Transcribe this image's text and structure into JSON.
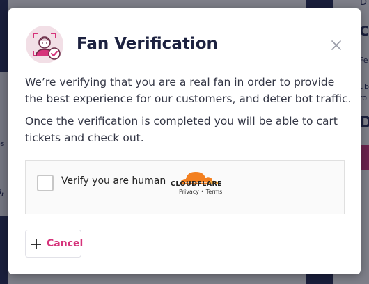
{
  "background": {
    "right_top_char": "D",
    "right_heading_char": "C",
    "right_small_1": "Fe",
    "right_small_2": "ub",
    "right_small_3": "ro",
    "right_big_char": "D",
    "left_small_1": "es",
    "left_small_2": "s,"
  },
  "modal": {
    "title": "Fan Verification",
    "paragraph_1": "We’re verifying that you are a real fan in order to provide the best experience for our customers, and deter bot traffic.",
    "paragraph_2": "Once the verification is completed you will be able to cart tickets and check out.",
    "icon": "fan-verification-icon",
    "close_icon": "close-icon"
  },
  "captcha": {
    "label": "Verify you are human",
    "brand": "CLOUDFLARE",
    "privacy_link": "Privacy",
    "separator": " • ",
    "terms_link": "Terms"
  },
  "actions": {
    "cancel_label": "Cancel",
    "cancel_icon": "plus-icon"
  },
  "colors": {
    "accent": "#d6337a",
    "title": "#1d2240",
    "navy": "#232b55",
    "cloudflare_orange": "#f38020"
  }
}
